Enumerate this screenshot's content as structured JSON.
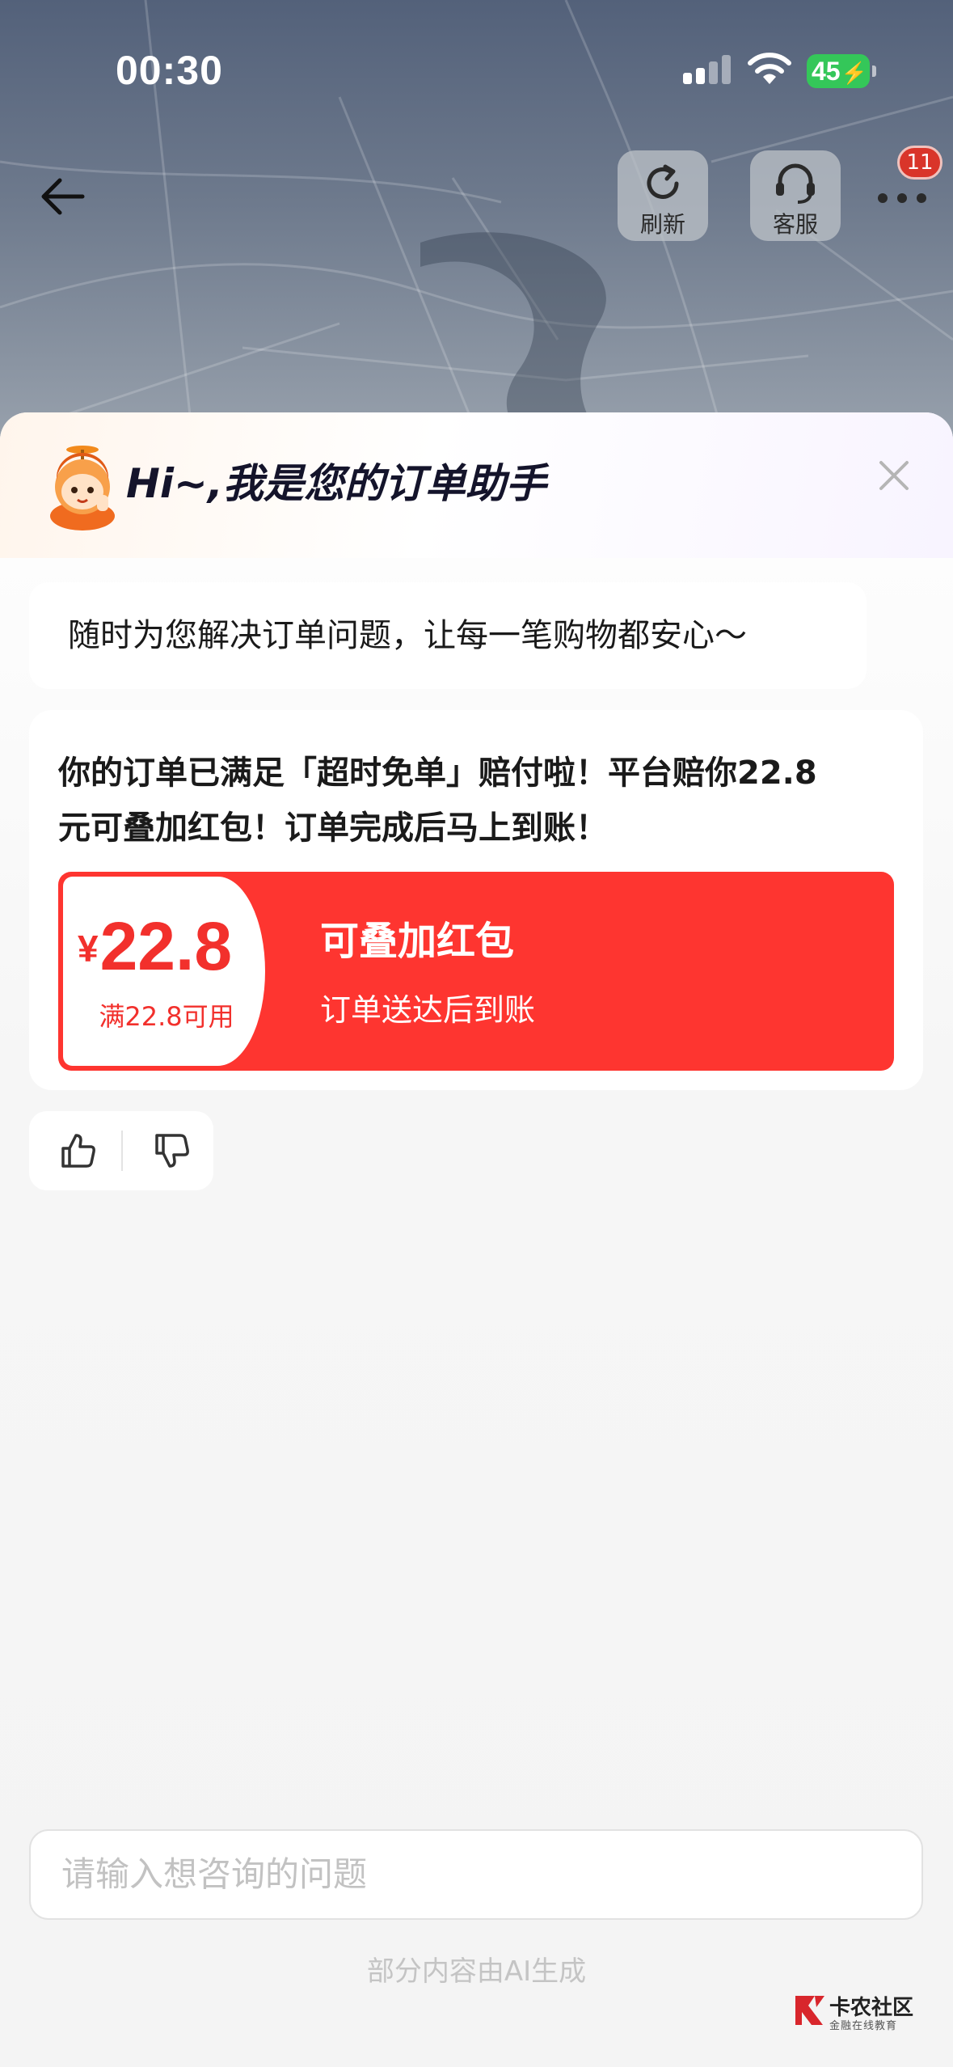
{
  "status_bar": {
    "time": "00:30",
    "battery": "45"
  },
  "nav": {
    "refresh_label": "刷新",
    "service_label": "客服",
    "badge_count": "11"
  },
  "assistant": {
    "greeting": "Hi~,我是您的订单助手",
    "intro": "随时为您解决订单问题，让每一笔购物都安心～"
  },
  "message": {
    "text_line1": "你的订单已满足「超时免单」赔付啦！平台赔你22.8",
    "text_line2": "元可叠加红包！订单完成后马上到账！"
  },
  "coupon": {
    "currency": "¥",
    "amount": "22.8",
    "condition": "满22.8可用",
    "title": "可叠加红包",
    "subtitle": "订单送达后到账"
  },
  "input": {
    "placeholder": "请输入想咨询的问题"
  },
  "footer": {
    "ai_note": "部分内容由AI生成"
  },
  "watermark": {
    "name": "卡农社区",
    "sub": "金融在线教育"
  },
  "colors": {
    "coupon_red": "#fe3530",
    "badge_red": "#d9352a",
    "battery_green": "#34c759"
  }
}
